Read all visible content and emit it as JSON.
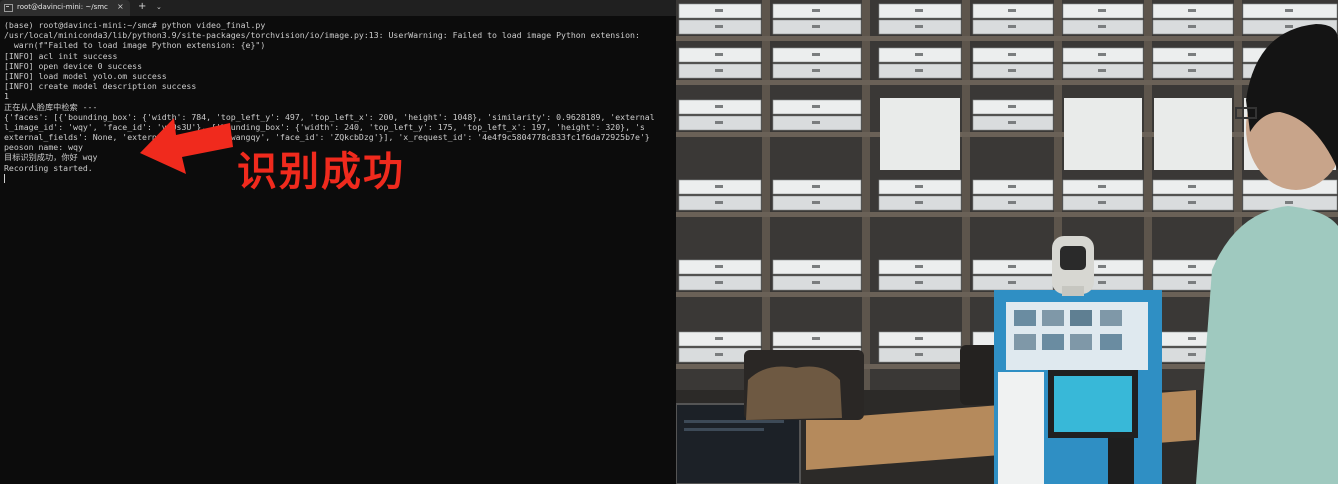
{
  "terminal": {
    "tab_title": "root@davinci-mini: ~/smc",
    "close_glyph": "×",
    "new_tab_glyph": "+",
    "dropdown_glyph": "⌄",
    "lines": [
      "(base) root@davinci-mini:~/smc# python video_final.py",
      "/usr/local/miniconda3/lib/python3.9/site-packages/torchvision/io/image.py:13: UserWarning: Failed to load image Python extension:",
      "  warn(f\"Failed to load image Python extension: {e}\")",
      "[INFO] acl init success",
      "[INFO] open device 0 success",
      "[INFO] load model yolo.om success",
      "[INFO] create model description success",
      "1",
      "正在从人脸库中检索 ---",
      "{'faces': [{'bounding_box': {'width': 784, 'top_left_y': 497, 'top_left_x': 200, 'height': 1048}, 'similarity': 0.9628189, 'external",
      "l_image_id': 'wqy', 'face_id': 'vmOs3U'}, {'bounding_box': {'width': 240, 'top_left_y': 175, 'top_left_x': 197, 'height': 320}, 's",
      "external_fields': None, 'external_image_id': 'wangqy', 'face_id': 'ZQkcbDzg'}], 'x_request_id': '4e4f9c5804778c833fc1f6da72925b7e'}",
      "peoson name: wqy",
      "目标识别成功，你好 wqy",
      "Recording started."
    ],
    "overlay_text": "识别成功"
  },
  "colors": {
    "terminal_bg": "#0c0c0c",
    "terminal_text": "#cccccc",
    "annotation_red": "#f02a1d",
    "kiosk_blue": "#2f8fc4"
  }
}
